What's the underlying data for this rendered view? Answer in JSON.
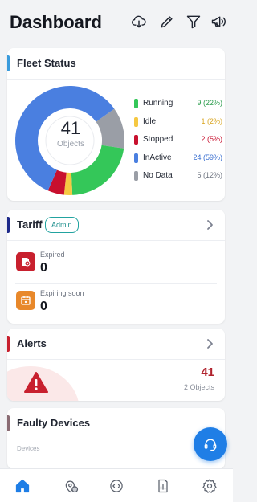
{
  "header": {
    "title": "Dashboard",
    "icons": [
      "cloud-download-icon",
      "pencil-icon",
      "filter-icon",
      "megaphone-icon"
    ]
  },
  "fleet_status": {
    "title": "Fleet Status",
    "accent": "#3a9bdc",
    "total": "41",
    "total_label": "Objects",
    "items": [
      {
        "label": "Running",
        "value": "9 (22%)",
        "count": 9,
        "color": "#34c759"
      },
      {
        "label": "Idle",
        "value": "1 (2%)",
        "count": 1,
        "color": "#f5c842"
      },
      {
        "label": "Stopped",
        "value": "2 (5%)",
        "count": 2,
        "color": "#c8102e"
      },
      {
        "label": "InActive",
        "value": "24 (59%)",
        "count": 24,
        "color": "#4a7fe0"
      },
      {
        "label": "No Data",
        "value": "5 (12%)",
        "count": 5,
        "color": "#9a9ea6"
      }
    ]
  },
  "tariff": {
    "title": "Tariff",
    "accent": "#1e2a8a",
    "badge": "Admin",
    "rows": [
      {
        "label": "Expired",
        "value": "0",
        "icon": "expired-icon",
        "color": "#c8202e"
      },
      {
        "label": "Expiring soon",
        "value": "0",
        "icon": "calendar-icon",
        "color": "#e8882a"
      }
    ]
  },
  "alerts": {
    "title": "Alerts",
    "accent": "#c8202e",
    "count": "41",
    "sub": "2 Objects",
    "icon": "warning-icon"
  },
  "faulty_devices": {
    "title": "Faulty Devices",
    "accent": "#8a6b73",
    "sub": "Devices"
  },
  "fab_icon": "headset-icon",
  "bottom_nav": [
    "home-icon",
    "map-icon",
    "chat-icon",
    "reports-icon",
    "settings-icon"
  ],
  "colors": {
    "primary": "#1f7ee6",
    "background": "#f2f3f5"
  }
}
